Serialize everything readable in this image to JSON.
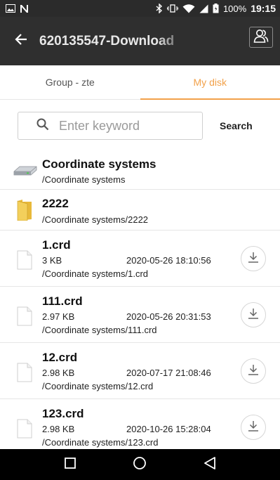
{
  "status_bar": {
    "battery": "100%",
    "time": "19:15"
  },
  "app_bar": {
    "title": "620135547-Download"
  },
  "tabs": [
    {
      "label": "Group - zte",
      "active": false
    },
    {
      "label": "My disk",
      "active": true
    }
  ],
  "search": {
    "placeholder": "Enter keyword",
    "value": "",
    "button_label": "Search"
  },
  "items": [
    {
      "name": "Coordinate systems",
      "path": "/Coordinate systems",
      "icon": "drive-icon"
    },
    {
      "name": "2222",
      "path": "/Coordinate systems/2222",
      "icon": "folder-icon"
    },
    {
      "name": "1.crd",
      "size": "3 KB",
      "date": "2020-05-26 18:10:56",
      "path": "/Coordinate systems/1.crd",
      "icon": "file-icon"
    },
    {
      "name": "111.crd",
      "size": "2.97 KB",
      "date": "2020-05-26 20:31:53",
      "path": "/Coordinate systems/111.crd",
      "icon": "file-icon"
    },
    {
      "name": "12.crd",
      "size": "2.98 KB",
      "date": "2020-07-17 21:08:46",
      "path": "/Coordinate systems/12.crd",
      "icon": "file-icon"
    },
    {
      "name": "123.crd",
      "size": "2.98 KB",
      "date": "2020-10-26 15:28:04",
      "path": "/Coordinate systems/123.crd",
      "icon": "file-icon"
    }
  ],
  "colors": {
    "accent": "#f2a14a",
    "app_bar": "#2f2f2f",
    "status_bar": "#2b2b2b"
  }
}
